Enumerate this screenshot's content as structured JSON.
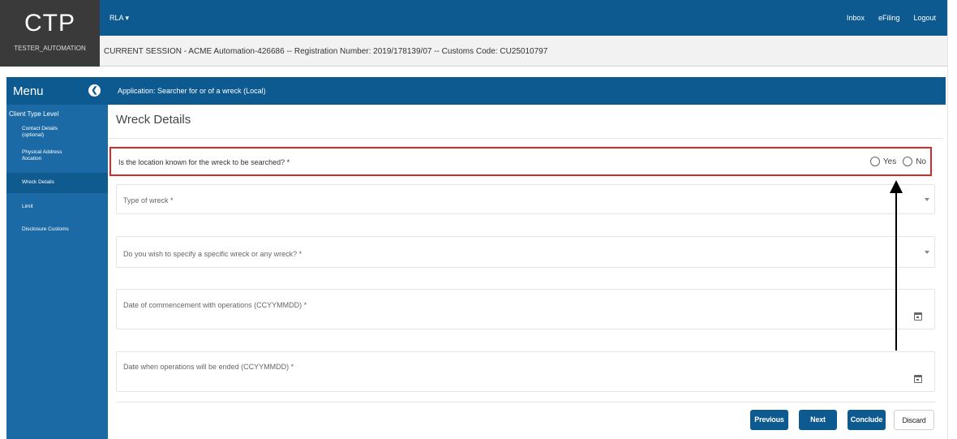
{
  "brand": {
    "logo": "CTP",
    "user": "TESTER_AUTOMATION"
  },
  "topbar": {
    "app_menu": "RLA",
    "links": [
      "Inbox",
      "eFiling",
      "Logout"
    ]
  },
  "session": "CURRENT SESSION - ACME Automation-426686 -- Registration Number: 2019/178139/07 -- Customs Code: CU25010797",
  "menu": {
    "title": "Menu",
    "group": "Client Type Level",
    "items": [
      {
        "label": "Contact Details (optional)",
        "active": false
      },
      {
        "label": "Physical Address /location",
        "active": false
      },
      {
        "label": "Wreck Details",
        "active": true
      },
      {
        "label": "Limit",
        "active": false
      },
      {
        "label": "Disclosure Customs",
        "active": false
      }
    ]
  },
  "application": "Application: Searcher for or of a wreck (Local)",
  "page": {
    "title": "Wreck Details",
    "question": "Is the location known for the wreck to be searched? *",
    "options": [
      "Yes",
      "No"
    ],
    "fields": {
      "type": "Type of wreck *",
      "specific": "Do you wish to specify a specific wreck or any wreck? *",
      "start": "Date of commencement with operations (CCYYMMDD) *",
      "end": "Date when operations will be ended (CCYYMMDD) *"
    }
  },
  "buttons": {
    "previous": "Previous",
    "next": "Next",
    "conclude": "Conclude",
    "discard": "Discard"
  },
  "colors": {
    "primary": "#0d5a91",
    "sidebar": "#1b6aa5",
    "highlight": "#d42a2a"
  }
}
